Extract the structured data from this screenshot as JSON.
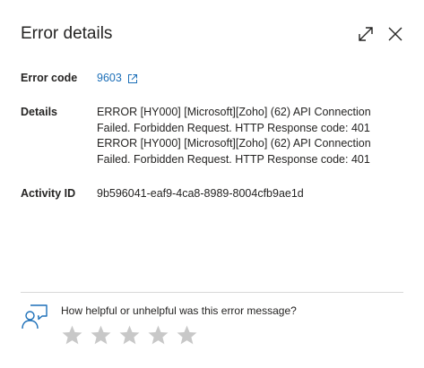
{
  "dialog": {
    "title": "Error details"
  },
  "fields": {
    "error_code": {
      "label": "Error code",
      "value": "9603"
    },
    "details": {
      "label": "Details",
      "value": "ERROR [HY000] [Microsoft][Zoho] (62) API Connection\nFailed. Forbidden Request. HTTP Response code: 401\nERROR [HY000] [Microsoft][Zoho] (62) API Connection\nFailed. Forbidden Request. HTTP Response code: 401"
    },
    "activity_id": {
      "label": "Activity ID",
      "value": "9b596041-eaf9-4ca8-8989-8004cfb9ae1d"
    }
  },
  "feedback": {
    "question": "How helpful or unhelpful was this error message?",
    "stars_total": 5,
    "stars_selected": 0
  },
  "colors": {
    "accent": "#1c6fb8",
    "star_empty": "#c8c8c8",
    "text": "#252423",
    "divider": "#d8d8d8"
  },
  "icons": {
    "expand": "expand-icon",
    "close": "close-icon",
    "external_link": "external-link-icon",
    "feedback": "feedback-person-icon",
    "star": "star-icon"
  }
}
